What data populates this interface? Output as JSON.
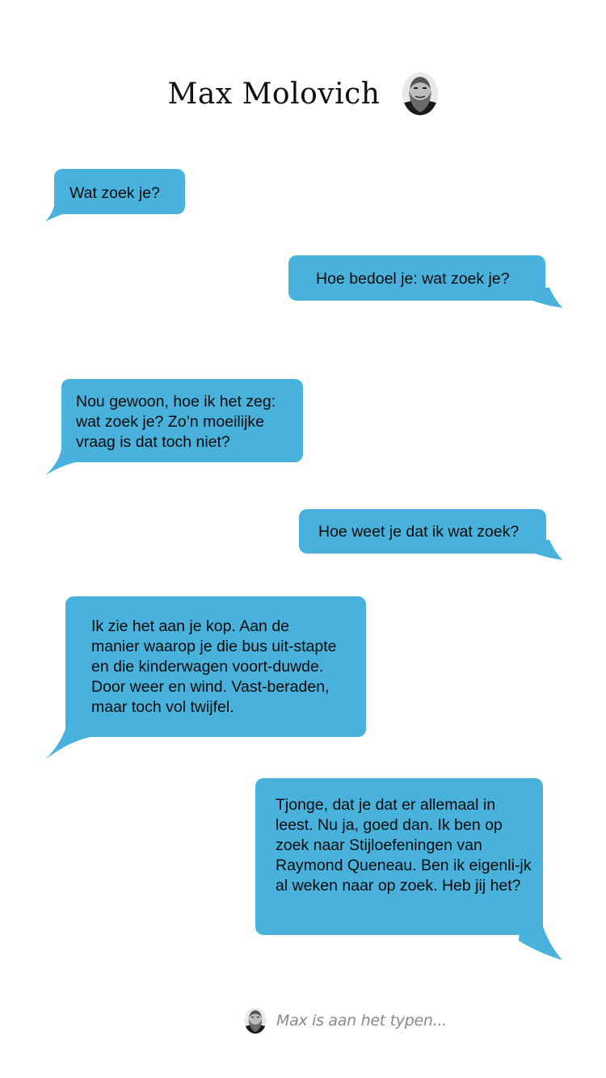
{
  "header": {
    "contact_name": "Max Molovich"
  },
  "messages": [
    {
      "side": "left",
      "text": "Wat zoek je?"
    },
    {
      "side": "right",
      "text": "Hoe bedoel je: wat zoek je?"
    },
    {
      "side": "left",
      "text": "Nou gewoon, hoe ik het zeg: wat zoek je? Zo’n moeilijke vraag is dat toch niet?"
    },
    {
      "side": "right",
      "text": "Hoe weet je dat ik wat zoek?"
    },
    {
      "side": "left",
      "text": "Ik zie het aan je kop. Aan de manier waarop je die bus uit-stapte en die kinderwagen voort-duwde. Door weer en wind. Vast-beraden, maar toch vol twijfel."
    },
    {
      "side": "right",
      "text": "Tjonge, dat je dat er allemaal in leest. Nu ja, goed dan. Ik ben op zoek naar Stijloefeningen van Raymond Queneau. Ben ik eigenli-jk al weken naar op zoek. Heb jij het?"
    }
  ],
  "typing_indicator": {
    "text": "Max is aan het typen..."
  },
  "colors": {
    "bubble": "#49b2dc",
    "text": "#0a0a0a",
    "typing_text": "#8a8a8a"
  },
  "icons": {
    "avatar": "bearded-man-avatar-icon"
  }
}
